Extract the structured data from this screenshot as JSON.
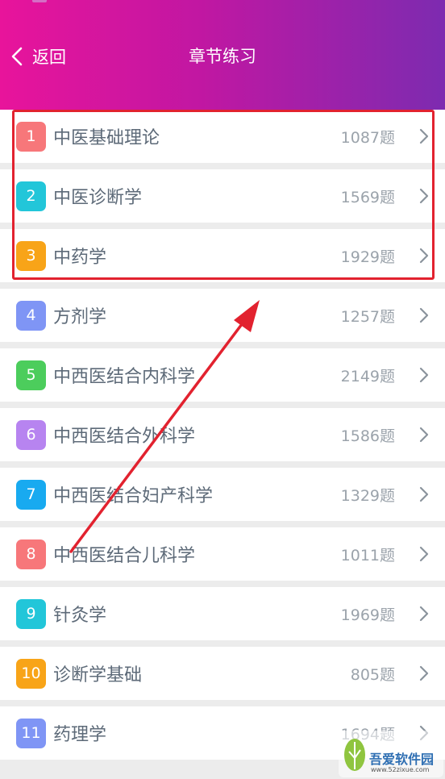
{
  "header": {
    "back_label": "返回",
    "title": "章节练习"
  },
  "chapters": [
    {
      "num": "1",
      "name": "中医基础理论",
      "count": "1087题",
      "color": "#f7777a"
    },
    {
      "num": "2",
      "name": "中医诊断学",
      "count": "1569题",
      "color": "#22c6d9"
    },
    {
      "num": "3",
      "name": "中药学",
      "count": "1929题",
      "color": "#f8a418"
    },
    {
      "num": "4",
      "name": "方剂学",
      "count": "1257题",
      "color": "#7f95f5"
    },
    {
      "num": "5",
      "name": "中西医结合内科学",
      "count": "2149题",
      "color": "#4ccd5c"
    },
    {
      "num": "6",
      "name": "中西医结合外科学",
      "count": "1586题",
      "color": "#b784f0"
    },
    {
      "num": "7",
      "name": "中西医结合妇产科学",
      "count": "1329题",
      "color": "#18aaf0"
    },
    {
      "num": "8",
      "name": "中西医结合儿科学",
      "count": "1011题",
      "color": "#f7777a"
    },
    {
      "num": "9",
      "name": "针灸学",
      "count": "1969题",
      "color": "#22c6d9"
    },
    {
      "num": "10",
      "name": "诊断学基础",
      "count": "805题",
      "color": "#f8a418"
    },
    {
      "num": "11",
      "name": "药理学",
      "count": "1694题",
      "color": "#7f95f5"
    }
  ],
  "annotation": {
    "color": "#e2222f"
  },
  "watermark": {
    "text": "吾爱软件园",
    "url": "www.52zixue.com"
  }
}
